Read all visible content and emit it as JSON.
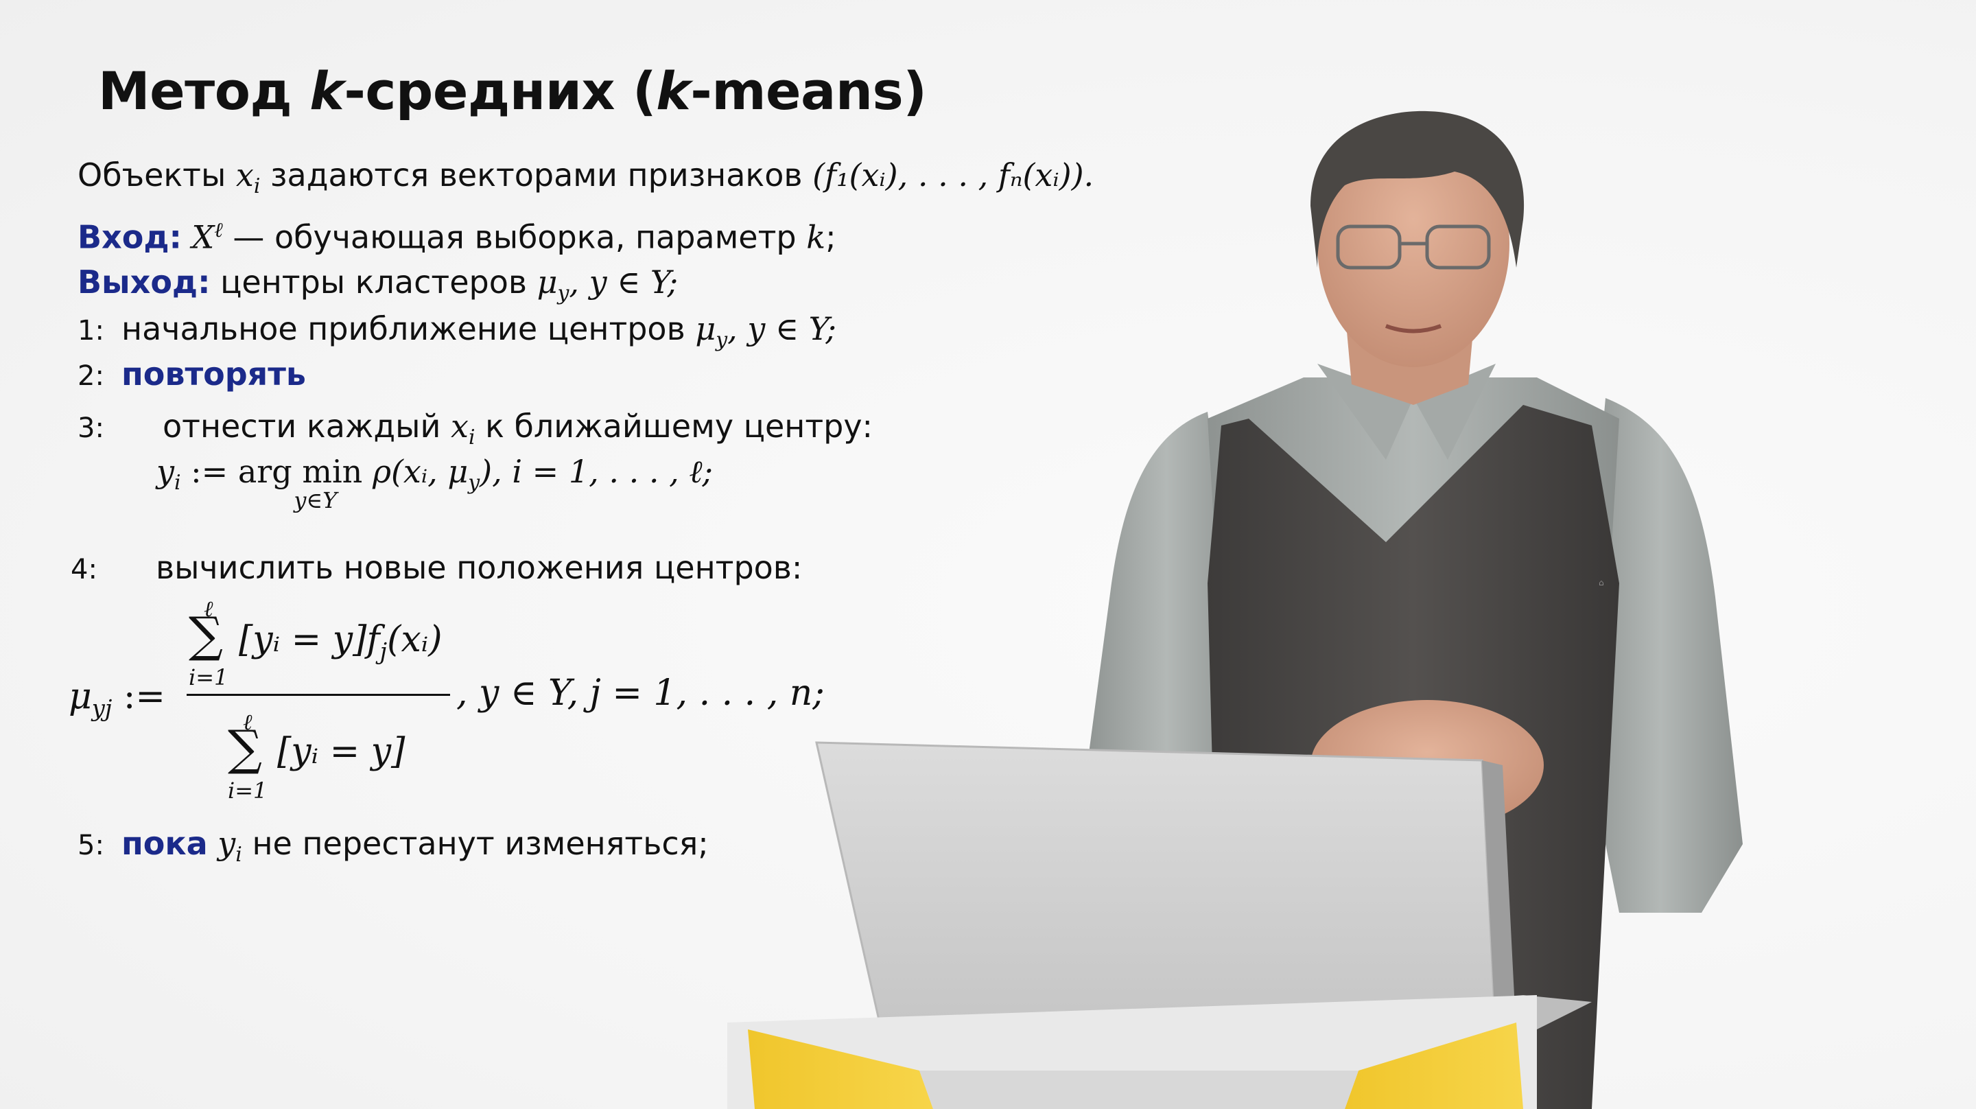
{
  "slide": {
    "title_prefix": "Метод ",
    "title_k1": "k",
    "title_mid": "-средних (",
    "title_k2": "k",
    "title_suffix": "-means)",
    "objects_text": "Объекты ",
    "objects_var": "x",
    "objects_sub": "i",
    "objects_tail": " задаются векторами признаков ",
    "objects_formula": "(f₁(xᵢ), . . . , fₙ(xᵢ)).",
    "input_label": "Вход:",
    "input_formula": "X",
    "input_sup": "ℓ",
    "input_text": " — обучающая выборка, параметр ",
    "input_k": "k",
    "input_end": ";",
    "output_label": "Выход:",
    "output_text": " центры кластеров ",
    "output_formula": "μ",
    "output_sub": "y",
    "output_tail": ", y ∈ Y;",
    "step1_num": "1:",
    "step1_text": "начальное приближение центров ",
    "step1_formula": "μ",
    "step1_sub": "y",
    "step1_tail": ",  y ∈ Y;",
    "step2_num": "2:",
    "step2_kw": "повторять",
    "step3_num": "3:",
    "step3_text": "отнести каждый ",
    "step3_var": "x",
    "step3_sub": "i",
    "step3_tail": " к ближайшему центру:",
    "step3_formula_lhs": "y",
    "step3_formula_sub": "i",
    "step3_formula_assign": " := arg ",
    "step3_min": "min",
    "step3_under": "y∈Y",
    "step3_formula_rhs": "ρ(xᵢ, μ",
    "step3_formula_rhs_sub": "y",
    "step3_formula_rhs_end": "),  i = 1, . . . , ℓ;",
    "step4_num": "4:",
    "step4_text": "вычислить новые положения центров:",
    "step4_lhs": "μ",
    "step4_lhs_sub": "yj",
    "step4_assign": " :=",
    "step4_num_upper": "ℓ",
    "step4_num_lower": "i=1",
    "step4_numerator": "[yᵢ = y]f",
    "step4_numerator_sub": "j",
    "step4_numerator_end": "(xᵢ)",
    "step4_den_upper": "ℓ",
    "step4_den_lower": "i=1",
    "step4_denominator": "[yᵢ = y]",
    "step4_tail": ",  y ∈ Y,  j = 1, . . . , n;",
    "step5_num": "5:",
    "step5_kw": "пока",
    "step5_var": " y",
    "step5_sub": "i",
    "step5_tail": " не перестанут изменяться;"
  },
  "colors": {
    "keyword": "#1b2a8a",
    "text": "#111111",
    "background": "#f6f6f6"
  }
}
